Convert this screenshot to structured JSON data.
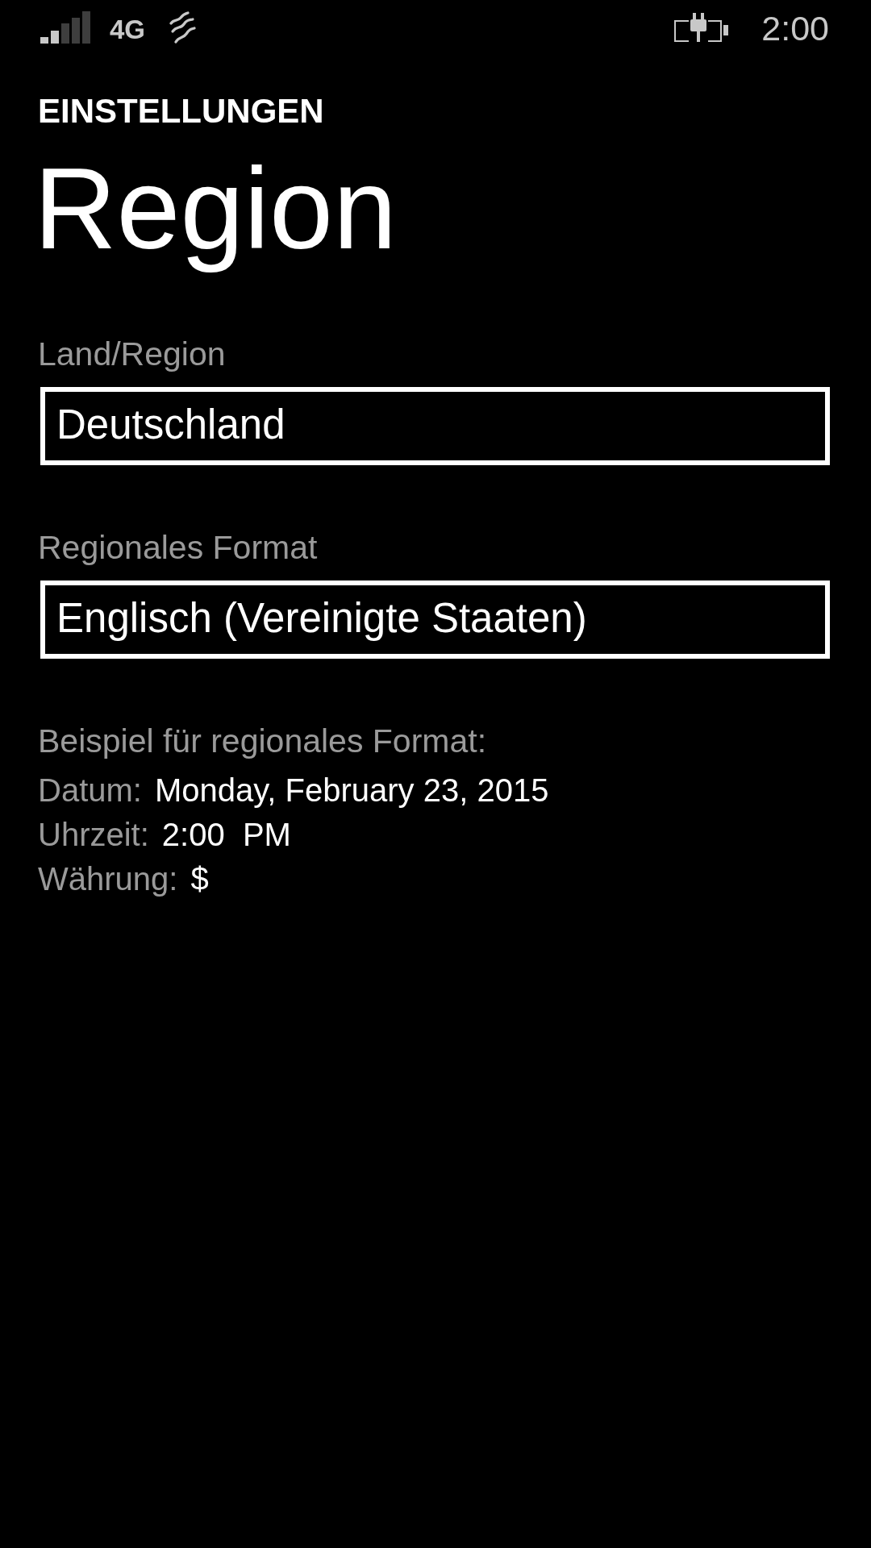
{
  "status_bar": {
    "network": "4G",
    "time": "2:00"
  },
  "header": {
    "section": "EINSTELLUNGEN",
    "title": "Region"
  },
  "fields": [
    {
      "label": "Land/Region",
      "value": "Deutschland"
    },
    {
      "label": "Regionales Format",
      "value": "Englisch (Vereinigte Staaten)"
    }
  ],
  "example": {
    "heading": "Beispiel für regionales Format:",
    "rows": [
      {
        "label": "Datum:",
        "value": "Monday, February 23, 2015"
      },
      {
        "label": "Uhrzeit:",
        "value": "2:00  PM"
      },
      {
        "label": "Währung:",
        "value": "$"
      }
    ]
  }
}
